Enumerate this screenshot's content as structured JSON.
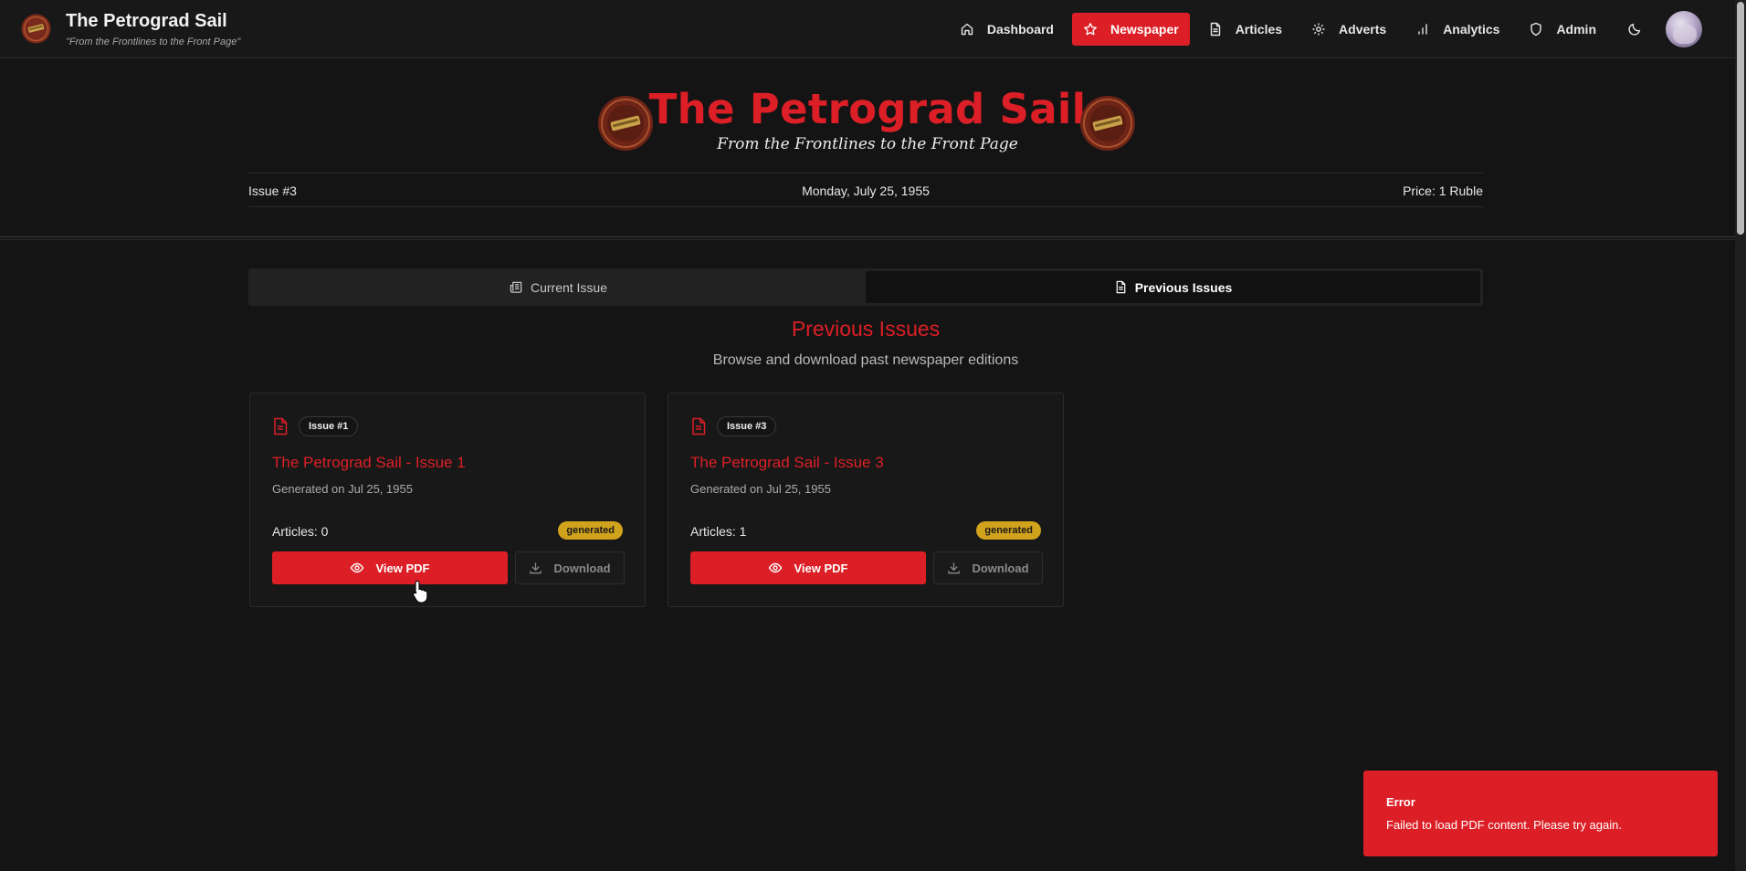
{
  "app": {
    "title": "The Petrograd Sail",
    "tagline": "\"From the Frontlines to the Front Page\""
  },
  "nav": {
    "items": [
      {
        "label": "Dashboard",
        "icon": "home-icon"
      },
      {
        "label": "Newspaper",
        "icon": "star-icon",
        "active": true
      },
      {
        "label": "Articles",
        "icon": "document-icon"
      },
      {
        "label": "Adverts",
        "icon": "gear-icon"
      },
      {
        "label": "Analytics",
        "icon": "bar-chart-icon"
      },
      {
        "label": "Admin",
        "icon": "shield-icon"
      }
    ],
    "theme_icon": "moon-icon"
  },
  "masthead": {
    "title": "The Petrograd Sail",
    "tagline": "From the Frontlines to the Front Page",
    "issue": "Issue #3",
    "date": "Monday, July 25, 1955",
    "price": "Price: 1 Ruble"
  },
  "tabs": [
    {
      "label": "Current Issue",
      "icon": "newspaper-icon"
    },
    {
      "label": "Previous Issues",
      "icon": "document-icon",
      "active": true
    }
  ],
  "section": {
    "title": "Previous Issues",
    "subtitle": "Browse and download past newspaper editions"
  },
  "issues": [
    {
      "badge": "Issue #1",
      "title": "The Petrograd Sail - Issue 1",
      "generated": "Generated on Jul 25, 1955",
      "articles": "Articles: 0",
      "status": "generated",
      "view_label": "View PDF",
      "download_label": "Download"
    },
    {
      "badge": "Issue #3",
      "title": "The Petrograd Sail - Issue 3",
      "generated": "Generated on Jul 25, 1955",
      "articles": "Articles: 1",
      "status": "generated",
      "view_label": "View PDF",
      "download_label": "Download"
    }
  ],
  "toast": {
    "title": "Error",
    "message": "Failed to load PDF content. Please try again."
  },
  "colors": {
    "accent": "#dc1f26",
    "background": "#141414",
    "status_generated": "#d1a21c"
  }
}
